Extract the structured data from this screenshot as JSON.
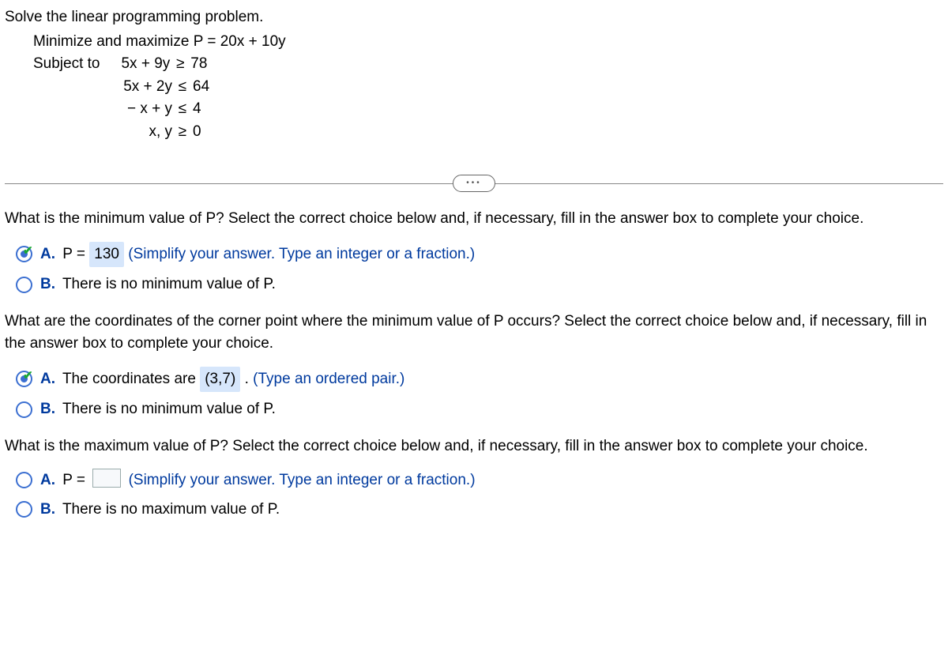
{
  "header": {
    "title": "Solve the linear programming problem."
  },
  "problem": {
    "objective_label": "Minimize and maximize",
    "objective_eq": "P = 20x + 10y",
    "subject_label": "Subject to",
    "constraints": [
      {
        "lhs": "5x + 9y",
        "rel": "≥",
        "rhs": "78"
      },
      {
        "lhs": "5x + 2y",
        "rel": "≤",
        "rhs": "64"
      },
      {
        "lhs": "− x + y",
        "rel": "≤",
        "rhs": "4"
      },
      {
        "lhs": "x, y",
        "rel": "≥",
        "rhs": "0"
      }
    ]
  },
  "q1": {
    "prompt": "What is the minimum value of P? Select the correct choice below and, if necessary, fill in the answer box to complete your choice.",
    "optA": {
      "letter": "A.",
      "pre": "P =",
      "value": "130",
      "hint": "(Simplify your answer. Type an integer or a fraction.)"
    },
    "optB": {
      "letter": "B.",
      "text": "There is no minimum value of P."
    }
  },
  "q2": {
    "prompt": "What are the coordinates of the corner point where the minimum value of P occurs? Select the correct choice below and, if necessary, fill in the answer box to complete your choice.",
    "optA": {
      "letter": "A.",
      "pre": "The coordinates are",
      "value": "(3,7)",
      "post": ".",
      "hint": "(Type an ordered pair.)"
    },
    "optB": {
      "letter": "B.",
      "text": "There is no minimum value of P."
    }
  },
  "q3": {
    "prompt": "What is the maximum value of P? Select the correct choice below and, if necessary, fill in the answer box to complete your choice.",
    "optA": {
      "letter": "A.",
      "pre": "P =",
      "hint": "(Simplify your answer. Type an integer or a fraction.)"
    },
    "optB": {
      "letter": "B.",
      "text": "There is no maximum value of P."
    }
  }
}
